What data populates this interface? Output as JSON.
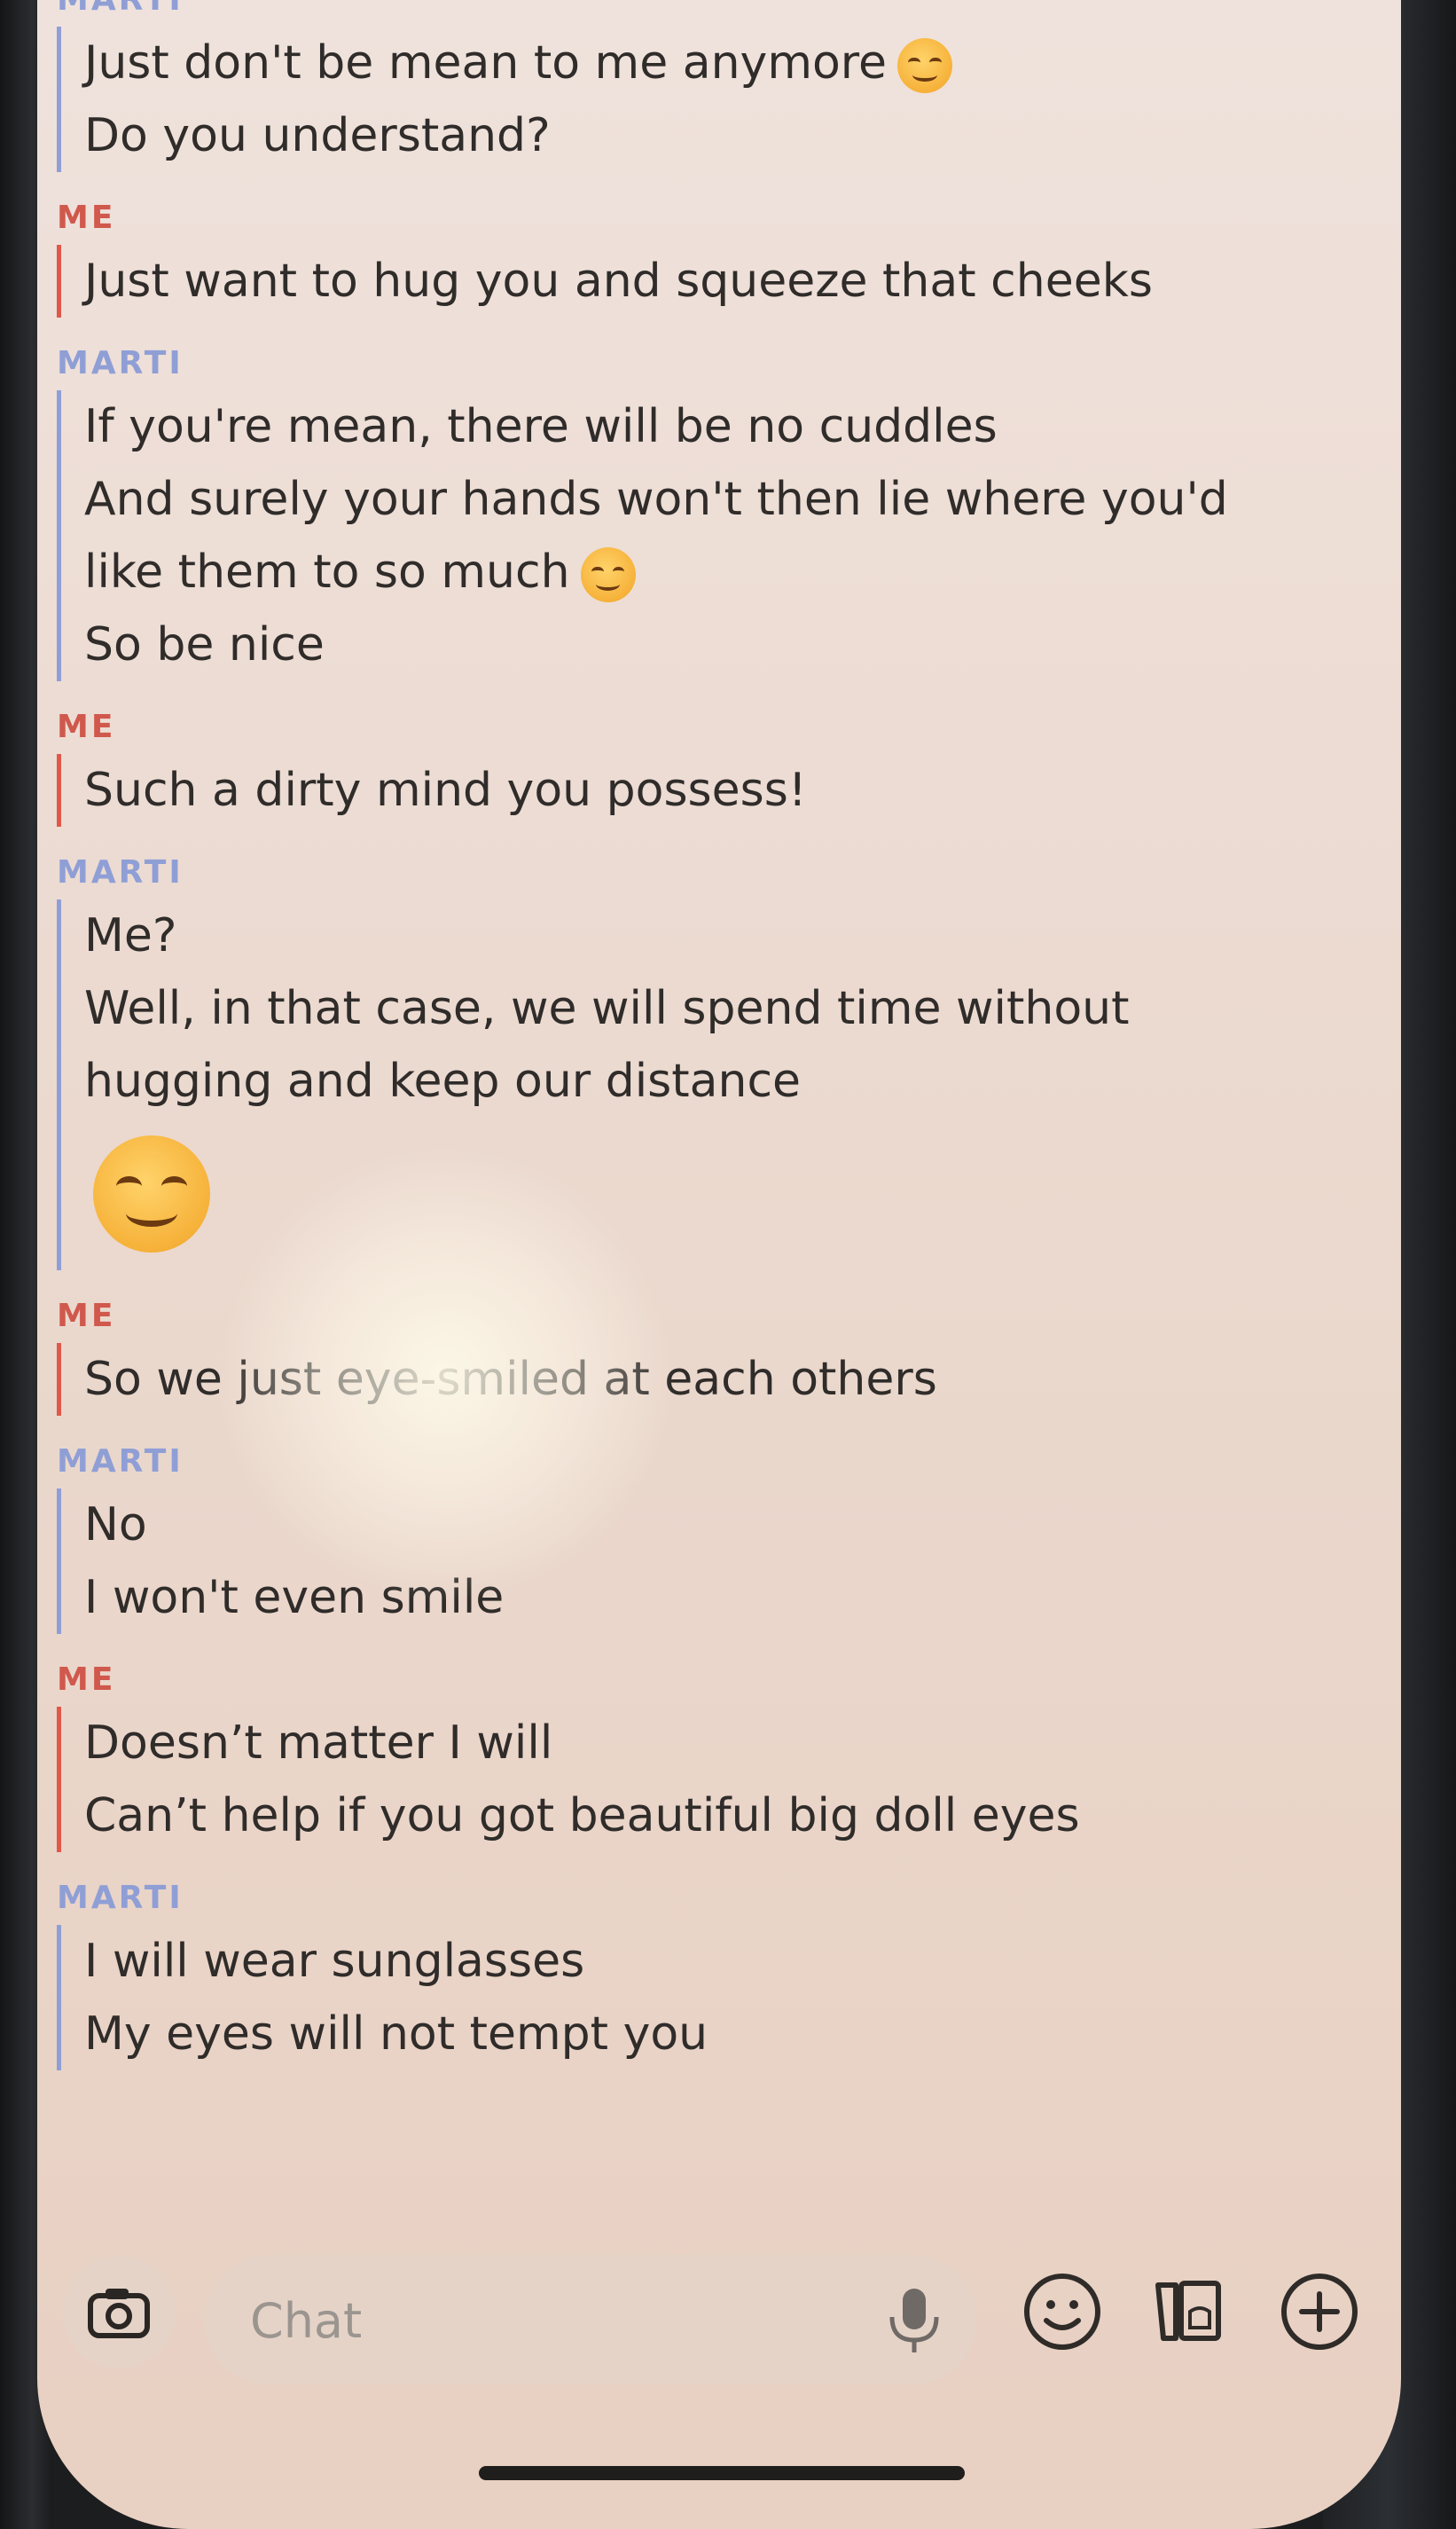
{
  "conversation": [
    {
      "sender": "MARTI",
      "lines": [
        {
          "text": "Just don't be mean to me anymore",
          "emoji": "steam-face-emoji"
        },
        {
          "text": "Do you understand?"
        }
      ]
    },
    {
      "sender": "ME",
      "lines": [
        {
          "text": "Just want to hug you and squeeze that cheeks"
        }
      ]
    },
    {
      "sender": "MARTI",
      "lines": [
        {
          "text": "If you're mean, there will be no cuddles"
        },
        {
          "text": "And surely your hands won't then lie where you'd"
        },
        {
          "text": "like them to so much",
          "emoji": "relieved-face-emoji"
        },
        {
          "text": "So be nice"
        }
      ]
    },
    {
      "sender": "ME",
      "lines": [
        {
          "text": "Such a dirty mind you possess!"
        }
      ]
    },
    {
      "sender": "MARTI",
      "lines": [
        {
          "text": "Me?"
        },
        {
          "text": "Well, in that case, we will spend time without"
        },
        {
          "text": "hugging and keep our distance"
        }
      ],
      "big_emoji": "smiling-eyes-emoji"
    },
    {
      "sender": "ME",
      "lines": [
        {
          "text": "So we just eye-smiled at each others"
        }
      ]
    },
    {
      "sender": "MARTI",
      "lines": [
        {
          "text": "No"
        },
        {
          "text": "I won't even smile"
        }
      ]
    },
    {
      "sender": "ME",
      "lines": [
        {
          "text": "Doesn’t matter I will"
        },
        {
          "text": "Can’t help if you got beautiful big doll eyes"
        }
      ]
    },
    {
      "sender": "MARTI",
      "lines": [
        {
          "text": "I will wear sunglasses"
        },
        {
          "text": "My eyes will not tempt you"
        }
      ]
    }
  ],
  "input": {
    "placeholder": "Chat",
    "value": ""
  },
  "icons": {
    "camera": "camera-icon",
    "mic": "microphone-icon",
    "emoji": "smiley-icon",
    "stickers": "sticker-cards-icon",
    "more": "plus-icon"
  },
  "colors": {
    "marti": "#8f9fd6",
    "me": "#e05849",
    "background": "#ecdcd3"
  }
}
